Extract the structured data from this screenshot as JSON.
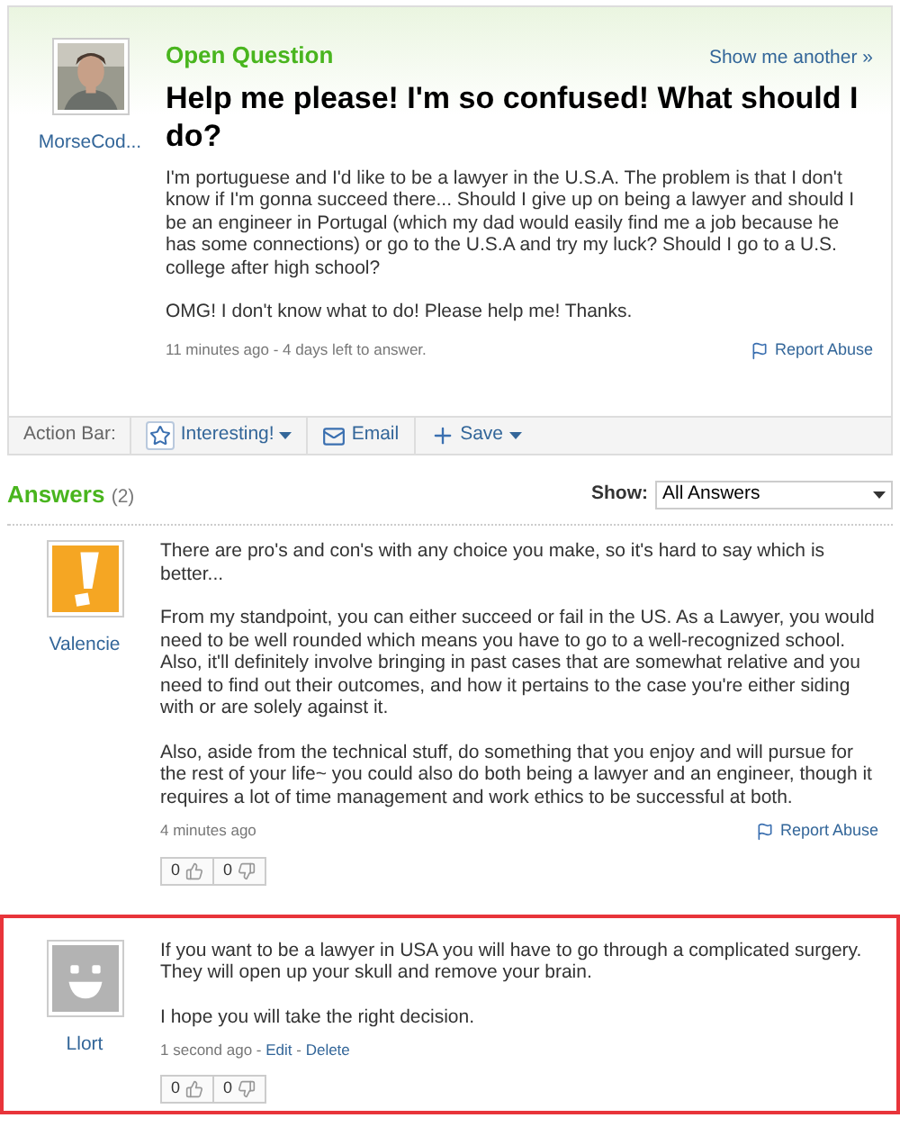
{
  "question": {
    "status": "Open Question",
    "show_another": "Show me another »",
    "asker": {
      "name": "MorseCod..."
    },
    "title": "Help me please! I'm so confused! What should I do?",
    "paragraphs": [
      "I'm portuguese and I'd like to be a lawyer in the U.S.A. The problem is that I don't know if I'm gonna succeed there... Should I give up on being a lawyer and should I be an engineer in Portugal (which my dad would easily find me a job because he has some connections) or go to the U.S.A and try my luck? Should I go to a U.S. college after high school?",
      "OMG! I don't know what to do! Please help me! Thanks."
    ],
    "meta": "11 minutes ago - 4 days left to answer.",
    "report": "Report Abuse"
  },
  "action_bar": {
    "label": "Action Bar:",
    "buttons": [
      {
        "label": "Interesting!",
        "kind": "star",
        "dropdown": true
      },
      {
        "label": "Email",
        "kind": "mail",
        "dropdown": false
      },
      {
        "label": "Save",
        "kind": "plus",
        "dropdown": true
      }
    ]
  },
  "answers": {
    "title": "Answers",
    "count": "(2)",
    "show_label": "Show:",
    "show_value": "All Answers",
    "items": [
      {
        "user": "Valencie",
        "avatar": {
          "kind": "alert"
        },
        "highlighted": false,
        "paragraphs": [
          "There are pro's and con's with any choice you make, so it's hard to say which is better...",
          "From my standpoint, you can either succeed or fail in the US. As a Lawyer, you would need to be well rounded which means you have to go to a well-recognized school. Also, it'll definitely involve bringing in past cases that are somewhat relative and you need to find out their outcomes, and how it pertains to the case you're either siding with or are solely against it.",
          "Also, aside from the technical stuff, do something that you enjoy and will pursue for the rest of your life~ you could also do both being a lawyer and an engineer, though it requires a lot of time management and work ethics to be successful at both."
        ],
        "meta": [
          {
            "kind": "plain",
            "text": "4 minutes ago"
          }
        ],
        "report": "Report Abuse",
        "up": "0",
        "down": "0"
      },
      {
        "user": "Llort",
        "avatar": {
          "kind": "smiley"
        },
        "highlighted": true,
        "paragraphs": [
          "If you want to be a lawyer in USA you will have to go through a complicated surgery. They will open up your skull and remove your brain.",
          "I hope you will take the right decision."
        ],
        "meta": [
          {
            "kind": "plain",
            "text": "1 second ago - "
          },
          {
            "kind": "link",
            "text": "Edit"
          },
          {
            "kind": "plain",
            "text": " - "
          },
          {
            "kind": "link",
            "text": "Delete"
          }
        ],
        "up": "0",
        "down": "0"
      }
    ]
  }
}
